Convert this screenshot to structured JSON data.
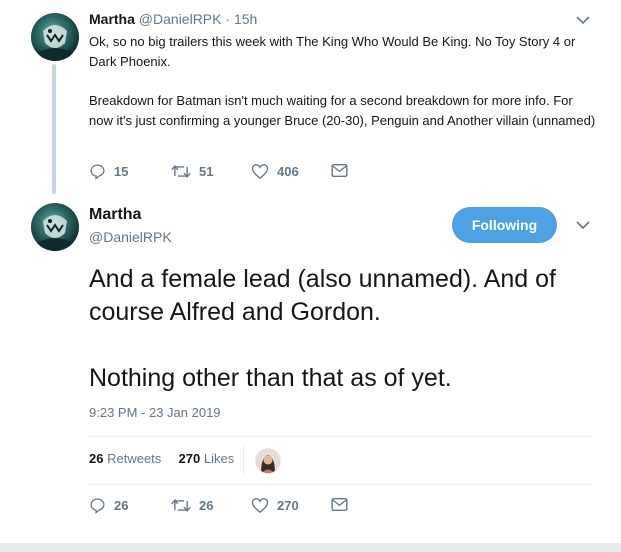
{
  "tweet1": {
    "name": "Martha",
    "handle": "@DanielRPK",
    "dot": "·",
    "time": "15h",
    "paragraph1": "Ok, so no big trailers this week with The King Who Would Be King. No Toy Story 4 or Dark Phoenix.",
    "paragraph2": "Breakdown for Batman isn't much waiting for a second breakdown for more info. For now it's just confirming a younger Bruce (20-30), Penguin and Another villain (unnamed)",
    "replies": "15",
    "retweets": "51",
    "likes": "406"
  },
  "tweet2": {
    "name": "Martha",
    "handle": "@DanielRPK",
    "follow_label": "Following",
    "paragraph1": "And a female lead (also unnamed). And of course Alfred and Gordon.",
    "paragraph2": "Nothing other than that as of yet.",
    "timestamp": "9:23 PM - 23 Jan 2019",
    "retweet_count": "26",
    "retweets_label": "Retweets",
    "like_count": "270",
    "likes_label": "Likes",
    "replies": "26",
    "retweets": "26",
    "likes": "270"
  },
  "icons": {
    "reply": "reply-icon",
    "retweet": "retweet-icon",
    "like": "heart-icon",
    "message": "envelope-icon",
    "menu": "chevron-down-icon"
  },
  "colors": {
    "accent": "#4ea1e4",
    "secondary_text": "#657786",
    "thread_line": "#c8d6e3"
  }
}
